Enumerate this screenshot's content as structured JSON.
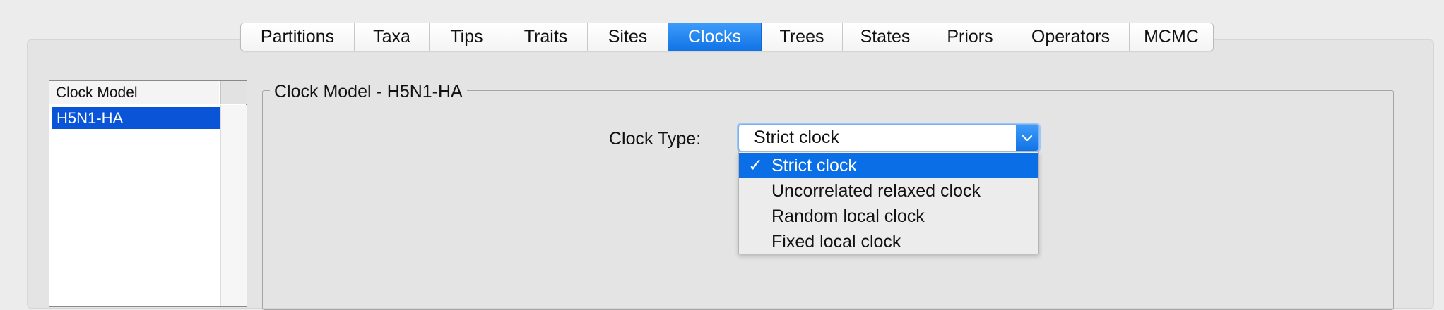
{
  "tabs": [
    {
      "label": "Partitions",
      "selected": false
    },
    {
      "label": "Taxa",
      "selected": false
    },
    {
      "label": "Tips",
      "selected": false
    },
    {
      "label": "Traits",
      "selected": false
    },
    {
      "label": "Sites",
      "selected": false
    },
    {
      "label": "Clocks",
      "selected": true
    },
    {
      "label": "Trees",
      "selected": false
    },
    {
      "label": "States",
      "selected": false
    },
    {
      "label": "Priors",
      "selected": false
    },
    {
      "label": "Operators",
      "selected": false
    },
    {
      "label": "MCMC",
      "selected": false
    }
  ],
  "clock_list": {
    "header": "Clock Model",
    "items": [
      {
        "label": "H5N1-HA",
        "selected": true
      }
    ]
  },
  "clock_panel": {
    "title": "Clock Model - H5N1-HA",
    "clock_type_label": "Clock Type:",
    "clock_type_value": "Strict clock",
    "options": [
      {
        "label": "Strict clock",
        "selected": true
      },
      {
        "label": "Uncorrelated relaxed clock",
        "selected": false
      },
      {
        "label": "Random local clock",
        "selected": false
      },
      {
        "label": "Fixed local clock",
        "selected": false
      }
    ],
    "check_mark": "✓"
  },
  "colors": {
    "accent": "#1173e6",
    "list_selection": "#0a55d7",
    "menu_selection": "#0a6ee6"
  },
  "icons": {
    "combo_arrow": "chevron-down-icon"
  }
}
